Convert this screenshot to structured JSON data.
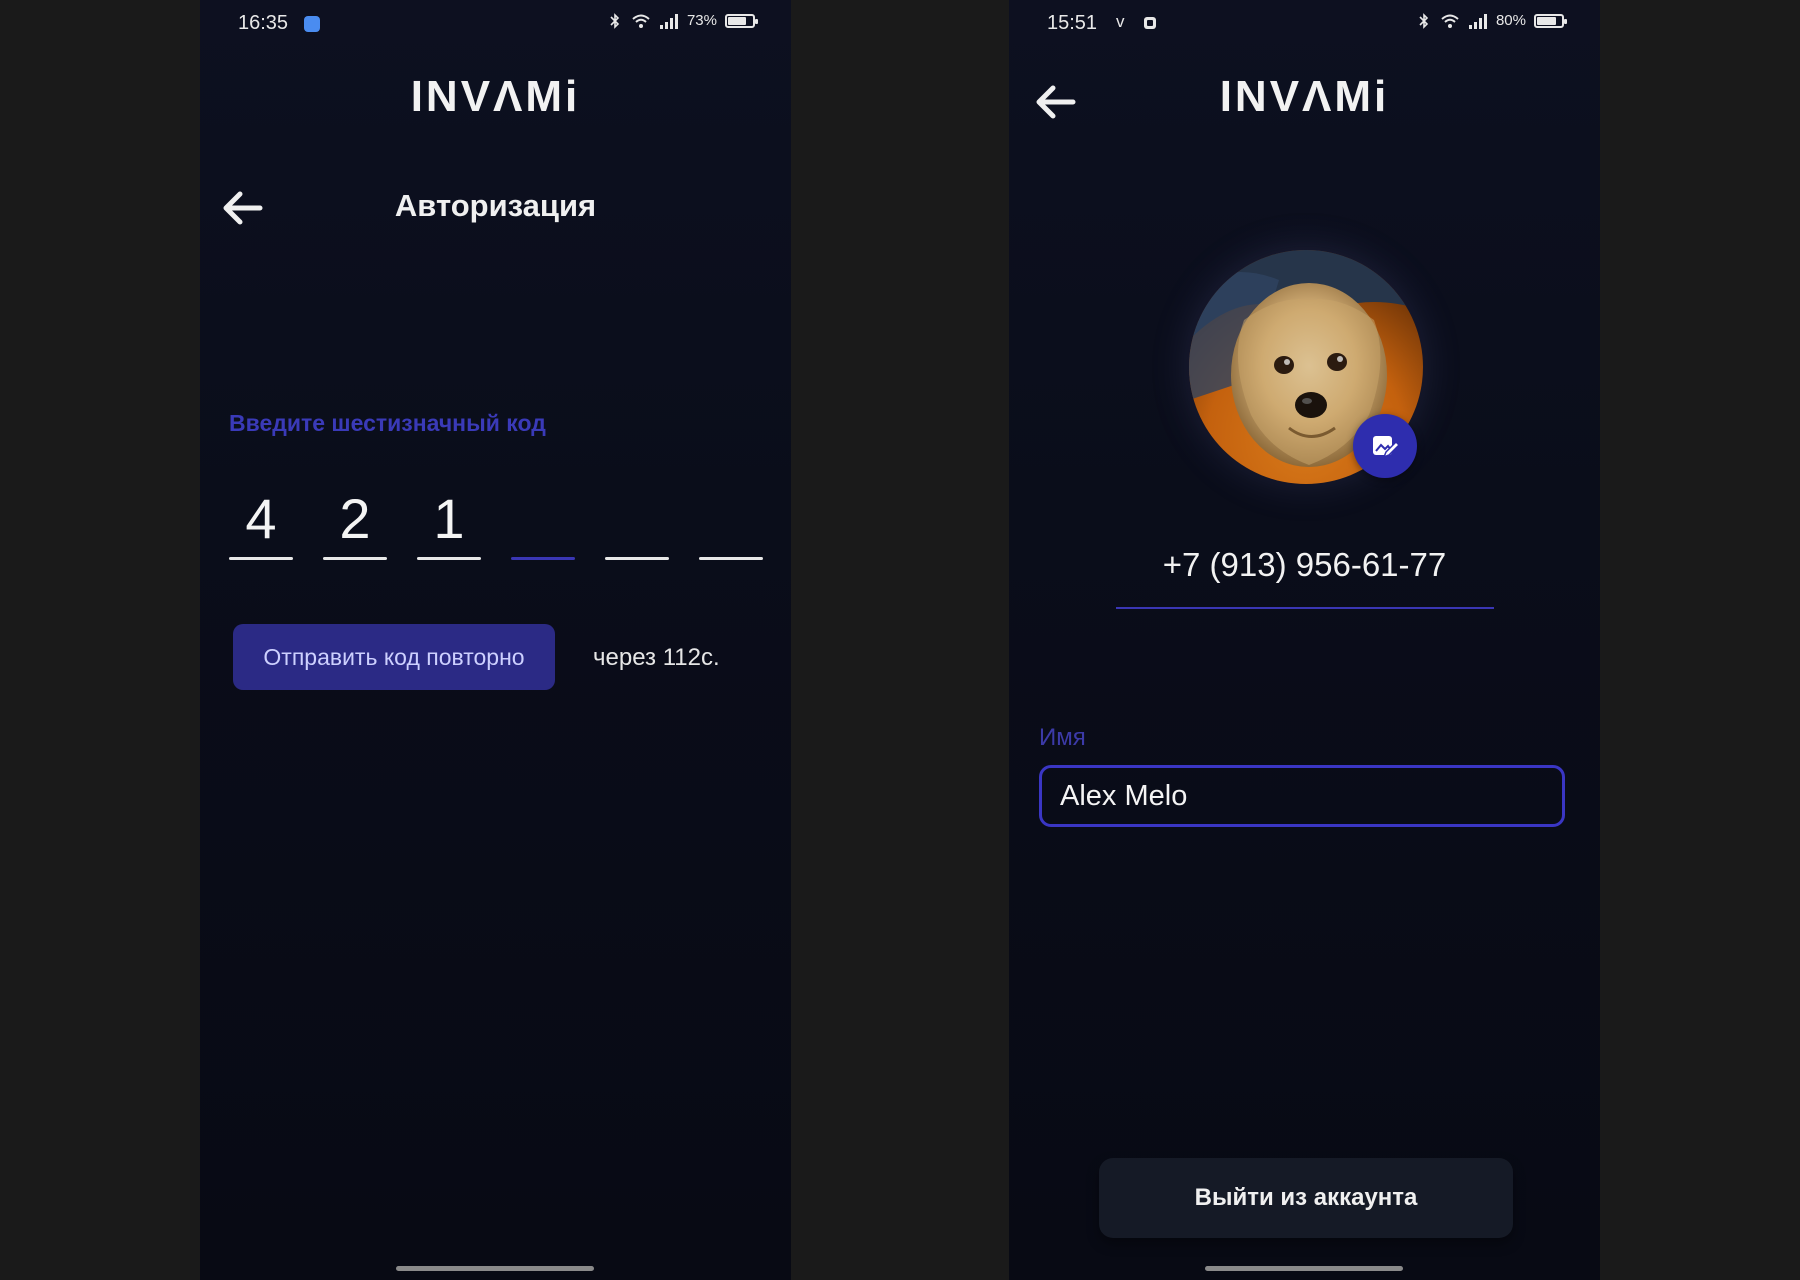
{
  "colors": {
    "accent": "#3a36b4",
    "accent_button": "#2b2a85",
    "label_blue": "#3a3ab8",
    "background": "#0a0d1a",
    "outer_background": "#1a1a1a"
  },
  "left_screen": {
    "status": {
      "time": "16:35",
      "battery": "73%",
      "app_icon": "blue-app-icon",
      "battery_level": 0.73
    },
    "logo": "INVΛMi",
    "title": "Авторизация",
    "code_label": "Введите шестизначный код",
    "code_digits": [
      "4",
      "2",
      "1",
      "",
      "",
      ""
    ],
    "active_code_index": 3,
    "resend_button": "Отправить код повторно",
    "resend_timer": "через 112с."
  },
  "right_screen": {
    "status": {
      "time": "15:51",
      "carrier_icon": "v",
      "battery": "80%",
      "battery_level": 0.8
    },
    "logo": "INVΛMi",
    "avatar": "yorkshire-terrier-photo",
    "phone_number": "+7 (913) 956-61-77",
    "name_label": "Имя",
    "name_value": "Alex Melo",
    "logout_button": "Выйти из аккаунта"
  }
}
